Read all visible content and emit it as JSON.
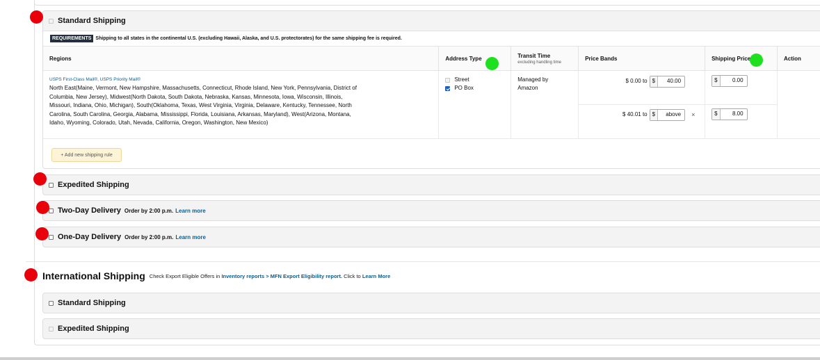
{
  "standard": {
    "title": "Standard Shipping",
    "requirements_badge": "REQUIREMENTS",
    "requirements_text": "Shipping to all states in the continental U.S. (excluding Hawaii, Alaska, and U.S. protectorates) for the same shipping fee is required.",
    "columns": {
      "regions": "Regions",
      "address_type": "Address Type",
      "transit_time": "Transit Time",
      "transit_time_sub": "excluding handling time",
      "price_bands": "Price Bands",
      "shipping_price": "Shipping Price",
      "action": "Action"
    },
    "row": {
      "mail_services": "USPS First-Class Mail®, USPS Priority Mail®",
      "regions": "North East(Maine, Vermont, New Hampshire, Massachusetts, Connecticut, Rhode Island, New York, Pennsylvania, District of Columbia, New Jersey), Midwest(North Dakota, South Dakota, Nebraska, Kansas, Minnesota, Iowa, Wisconsin, Illinois, Missouri, Indiana, Ohio, Michigan), South(Oklahoma, Texas, West Virginia, Virginia, Delaware, Kentucky, Tennessee, North Carolina, South Carolina, Georgia, Alabama, Mississippi, Florida, Louisiana, Arkansas, Maryland), West(Arizona, Montana, Idaho, Wyoming, Colorado, Utah, Nevada, California, Oregon, Washington, New Mexico)",
      "address_types": [
        {
          "label": "Street",
          "checked": false,
          "disabled": true
        },
        {
          "label": "PO Box",
          "checked": true,
          "disabled": false
        }
      ],
      "transit_time": "Managed by Amazon",
      "bands": [
        {
          "from": "$ 0.00 to",
          "currency": "$",
          "to": "40.00",
          "price_currency": "$",
          "price": "0.00"
        },
        {
          "from": "$ 40.01 to",
          "currency": "$",
          "to": "above",
          "remove": "×",
          "price_currency": "$",
          "price": "8.00"
        }
      ]
    },
    "add_rule": "+ Add new shipping rule"
  },
  "expedited": {
    "title": "Expedited Shipping"
  },
  "two_day": {
    "title": "Two-Day Delivery",
    "order_by": "Order by 2:00 p.m.",
    "learn_more": "Learn more"
  },
  "one_day": {
    "title": "One-Day Delivery",
    "order_by": "Order by 2:00 p.m.",
    "learn_more": "Learn more"
  },
  "international": {
    "title": "International Shipping",
    "text_before": "Check Export Eligible Offers in",
    "report_link": "Inventory reports > MFN Export Eligibility report.",
    "text_after": "Click to",
    "learn_more": "Learn More",
    "standard": "Standard Shipping",
    "expedited": "Expedited Shipping"
  },
  "colors": {
    "marker_red": "#e8000b",
    "marker_green": "#1fe01f",
    "link": "#0a5e8f",
    "badge_bg": "#232f3e"
  }
}
